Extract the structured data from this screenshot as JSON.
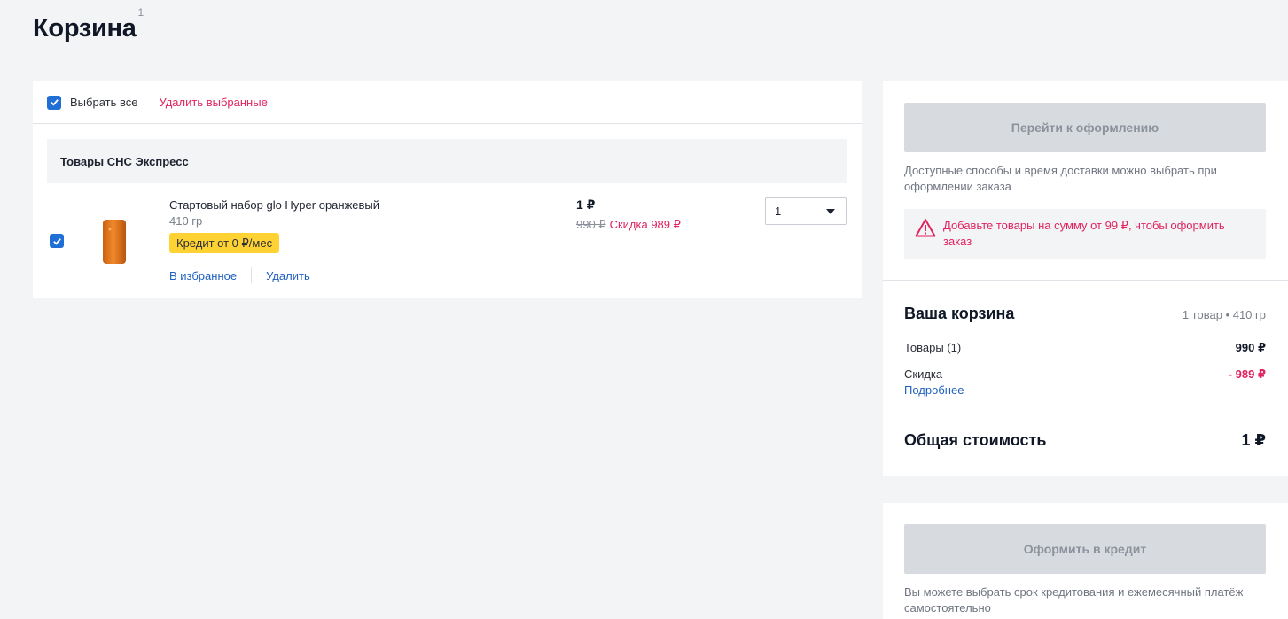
{
  "page": {
    "title": "Корзина",
    "title_count": "1"
  },
  "cart": {
    "select_all_label": "Выбрать все",
    "delete_selected_label": "Удалить выбранные",
    "group_title": "Товары СНС Экспресс",
    "item": {
      "name": "Стартовый набор glo Hyper оранжевый",
      "weight": "410 гр",
      "credit_badge": "Кредит от 0 ₽/мес",
      "favorite_link": "В избранное",
      "delete_link": "Удалить",
      "price": "1 ₽",
      "old_price": "990 ₽",
      "discount": "Скидка 989 ₽",
      "quantity": "1",
      "image_color": "#e07a1f"
    }
  },
  "order": {
    "checkout_button": "Перейти к оформлению",
    "delivery_note": "Доступные способы и время доставки можно выбрать при оформлении заказа",
    "warning": "Добавьте товары на сумму от 99 ₽, чтобы оформить заказ",
    "summary_title": "Ваша корзина",
    "summary_meta": "1 товар • 410 гр",
    "goods_label": "Товары (1)",
    "goods_value": "990 ₽",
    "discount_label": "Скидка",
    "discount_value": "- 989 ₽",
    "more_link": "Подробнее",
    "total_label": "Общая стоимость",
    "total_value": "1 ₽"
  },
  "credit": {
    "button": "Оформить в кредит",
    "note": "Вы можете выбрать срок кредитования и ежемесячный платёж самостоятельно"
  },
  "colors": {
    "accent_blue": "#1f6fd7",
    "link_blue": "#1f5fbf",
    "alert_pink": "#e0245e",
    "badge_yellow": "#ffd233",
    "disabled_button": "#d7dbe0"
  }
}
